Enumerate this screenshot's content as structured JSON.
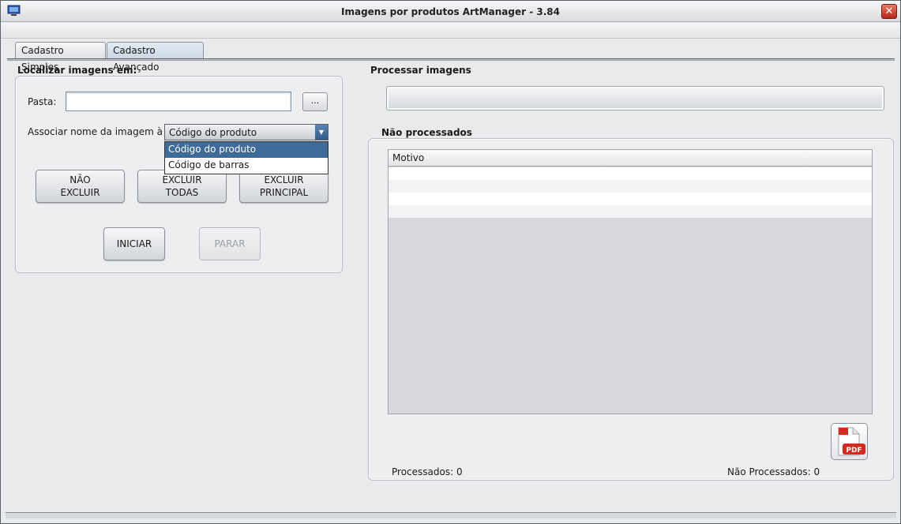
{
  "window": {
    "title": "Imagens por produtos ArtManager - 3.84",
    "close_label": "✕"
  },
  "tabs": [
    {
      "label": "Cadastro Simples",
      "active": false
    },
    {
      "label": "Cadastro Avançado",
      "active": true
    }
  ],
  "left_panel": {
    "title": "Localizar imagens em:",
    "folder_label": "Pasta:",
    "folder_value": "",
    "browse_label": "...",
    "associate_label": "Associar nome da imagem à :",
    "associate_selected": "Código do produto",
    "associate_options": [
      "Código do produto",
      "Código de barras"
    ],
    "buttons": {
      "nao_excluir": "NÃO\nEXCLUIR",
      "excluir_todas": "EXCLUIR\nTODAS",
      "excluir_principal": "EXCLUIR\nPRINCIPAL",
      "iniciar": "INICIAR",
      "parar": "PARAR"
    }
  },
  "right_panel": {
    "title": "Processar imagens",
    "not_processed_title": "Não processados",
    "table_header": "Motivo",
    "pdf_label": "PDF",
    "processed_label": "Processados:",
    "processed_count": "0",
    "not_processed_label": "Não Processados:",
    "not_processed_count": "0"
  },
  "colors": {
    "accent": "#3f6b9a",
    "close": "#b8261a",
    "pdf_red": "#d42a1e"
  }
}
